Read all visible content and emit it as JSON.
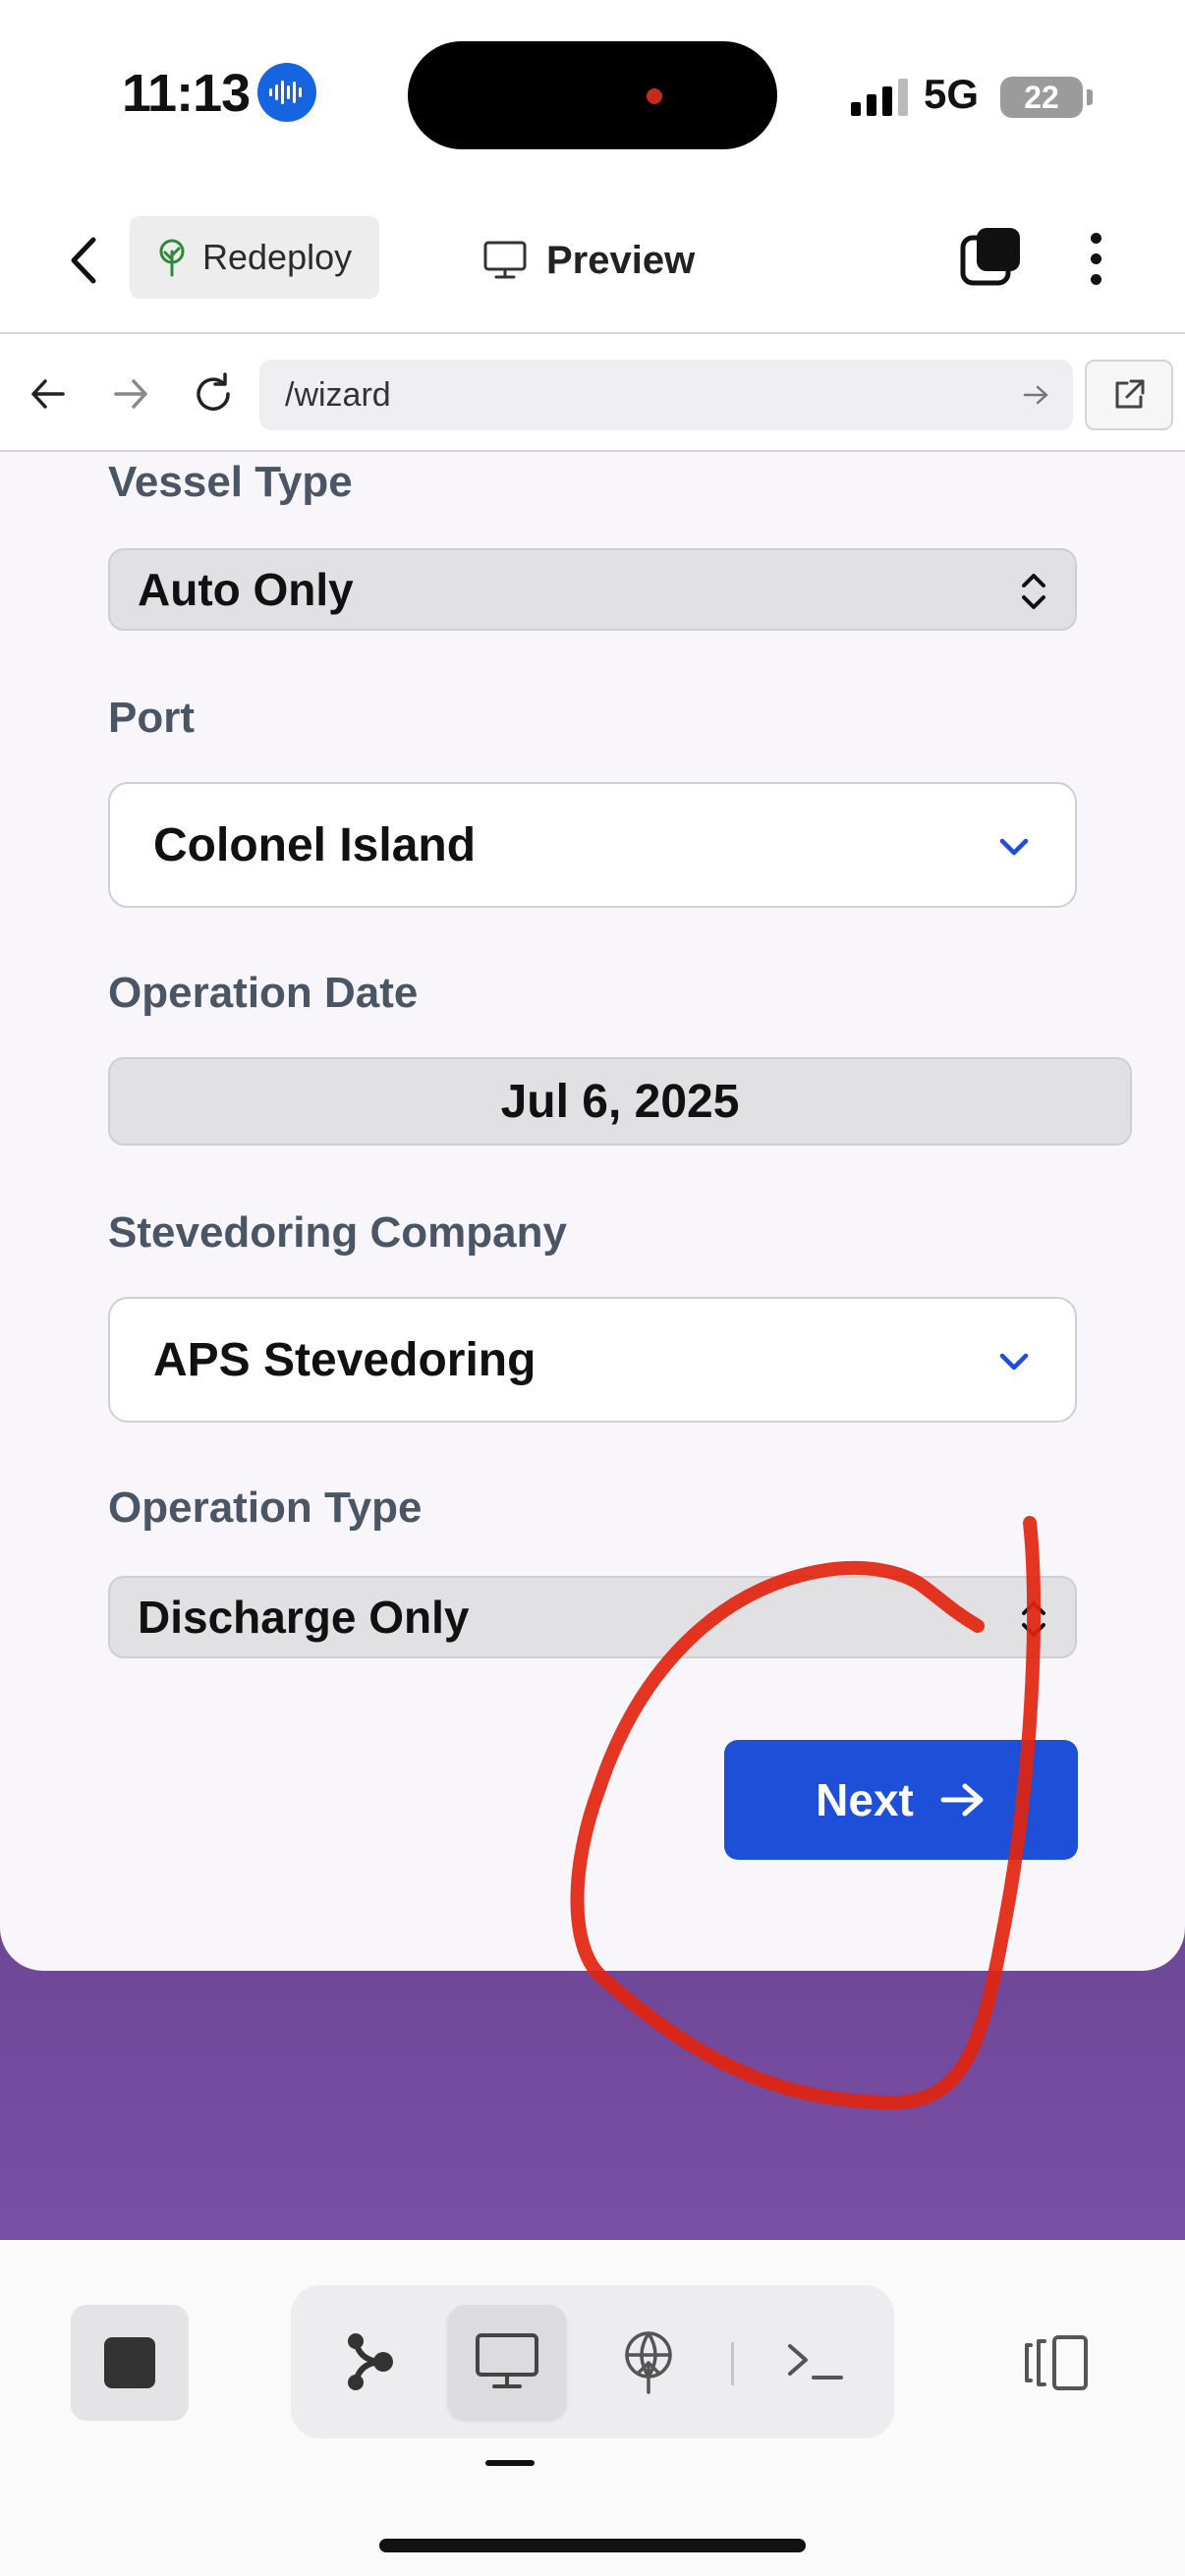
{
  "status_bar": {
    "time": "11:13",
    "network": "5G",
    "battery": "22"
  },
  "header": {
    "redeploy_label": "Redeploy",
    "preview_label": "Preview"
  },
  "browser": {
    "url": "/wizard"
  },
  "form": {
    "vessel_type": {
      "label": "Vessel Type",
      "value": "Auto Only"
    },
    "port": {
      "label": "Port",
      "value": "Colonel Island"
    },
    "operation_date": {
      "label": "Operation Date",
      "value": "Jul 6, 2025"
    },
    "stevedoring_company": {
      "label": "Stevedoring Company",
      "value": "APS Stevedoring"
    },
    "operation_type": {
      "label": "Operation Type",
      "value": "Discharge Only"
    },
    "next_label": "Next"
  },
  "colors": {
    "accent": "#1d4fd8",
    "purple_bg": "#7a4fa6",
    "annotation": "#e1240f"
  },
  "icons": [
    "voice-memo-icon",
    "chevron-left-icon",
    "tree-icon",
    "monitor-icon",
    "layers-icon",
    "more-icon",
    "arrow-left-icon",
    "arrow-right-icon",
    "reload-icon",
    "external-link-icon",
    "chevron-down-icon",
    "updown-icon",
    "stop-icon",
    "branch-icon",
    "deploy-icon",
    "terminal-icon",
    "panel-icon"
  ]
}
